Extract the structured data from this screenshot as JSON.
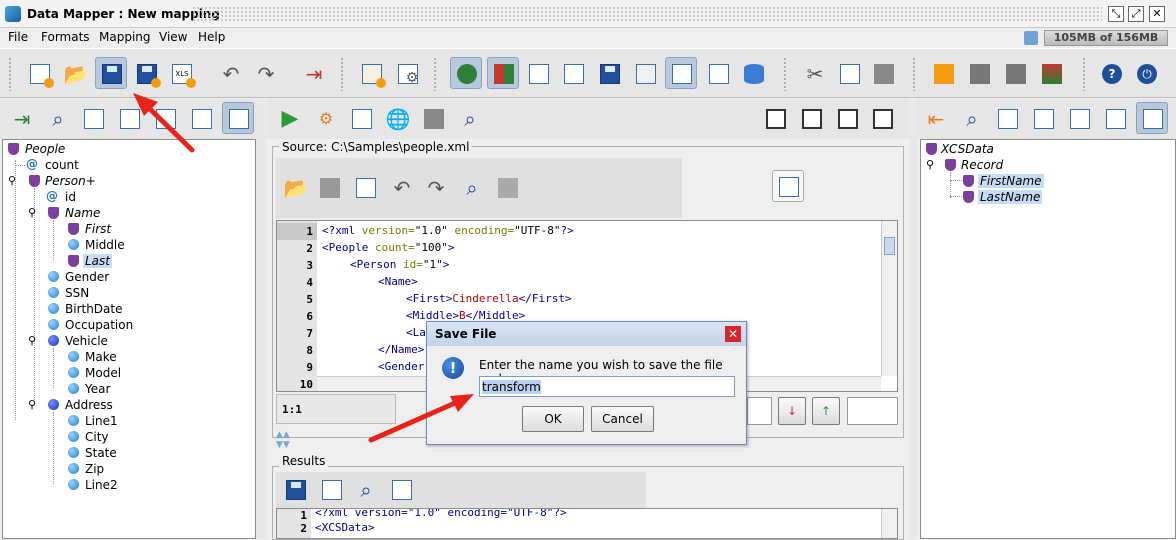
{
  "window": {
    "title": "Data Mapper : New mapping"
  },
  "menu": [
    "File",
    "Formats",
    "Mapping",
    "View",
    "Help"
  ],
  "memory": "105MB of 156MB",
  "source": {
    "label": "Source: C:\\Samples\\people.xml",
    "position": "1:1",
    "lines": [
      "1",
      "2",
      "3",
      "4",
      "5",
      "6",
      "7",
      "8",
      "9",
      "10"
    ],
    "code": {
      "l1_decl_open": "<?xml",
      "l1_version_attr": "version=",
      "l1_version_val": "\"1.0\"",
      "l1_enc_attr": "encoding=",
      "l1_enc_val": "\"UTF-8\"",
      "l1_close": "?>",
      "l2_open": "<People",
      "l2_attr": "count=",
      "l2_val": "\"100\"",
      "l2_close": ">",
      "l3_open": "<Person",
      "l3_attr": "id=",
      "l3_val": "\"1\"",
      "l3_close": ">",
      "l4": "<Name>",
      "l5_open": "<First>",
      "l5_text": "Cinderella",
      "l5_close": "</First>",
      "l6_open": "<Middle>",
      "l6_text": "B",
      "l6_close": "</Middle>",
      "l7": "<La",
      "l8": "</Name>",
      "l9": "<Gender"
    }
  },
  "results": {
    "label": "Results",
    "lines": [
      "1",
      "2"
    ],
    "line1": "<?xml version=\"1.0\" encoding=\"UTF-8\"?>",
    "line2": "<XCSData>"
  },
  "left_tree": {
    "root": "People",
    "items": {
      "count": "count",
      "person": "Person+",
      "id": "id",
      "name": "Name",
      "first": "First",
      "middle": "Middle",
      "last": "Last",
      "gender": "Gender",
      "ssn": "SSN",
      "birthdate": "BirthDate",
      "occupation": "Occupation",
      "vehicle": "Vehicle",
      "make": "Make",
      "model": "Model",
      "year": "Year",
      "address": "Address",
      "line1": "Line1",
      "city": "City",
      "state": "State",
      "zip": "Zip",
      "line2": "Line2"
    }
  },
  "right_tree": {
    "root": "XCSData",
    "record": "Record",
    "firstname": "FirstName",
    "lastname": "LastName"
  },
  "dialog": {
    "title": "Save File",
    "prompt": "Enter the name you wish to save the file under:",
    "value": "transform",
    "ok": "OK",
    "cancel": "Cancel"
  },
  "colors": {
    "annotation_arrow": "#e8231c",
    "selection": "#c6dcf5",
    "dialog_close": "#d9252a"
  }
}
